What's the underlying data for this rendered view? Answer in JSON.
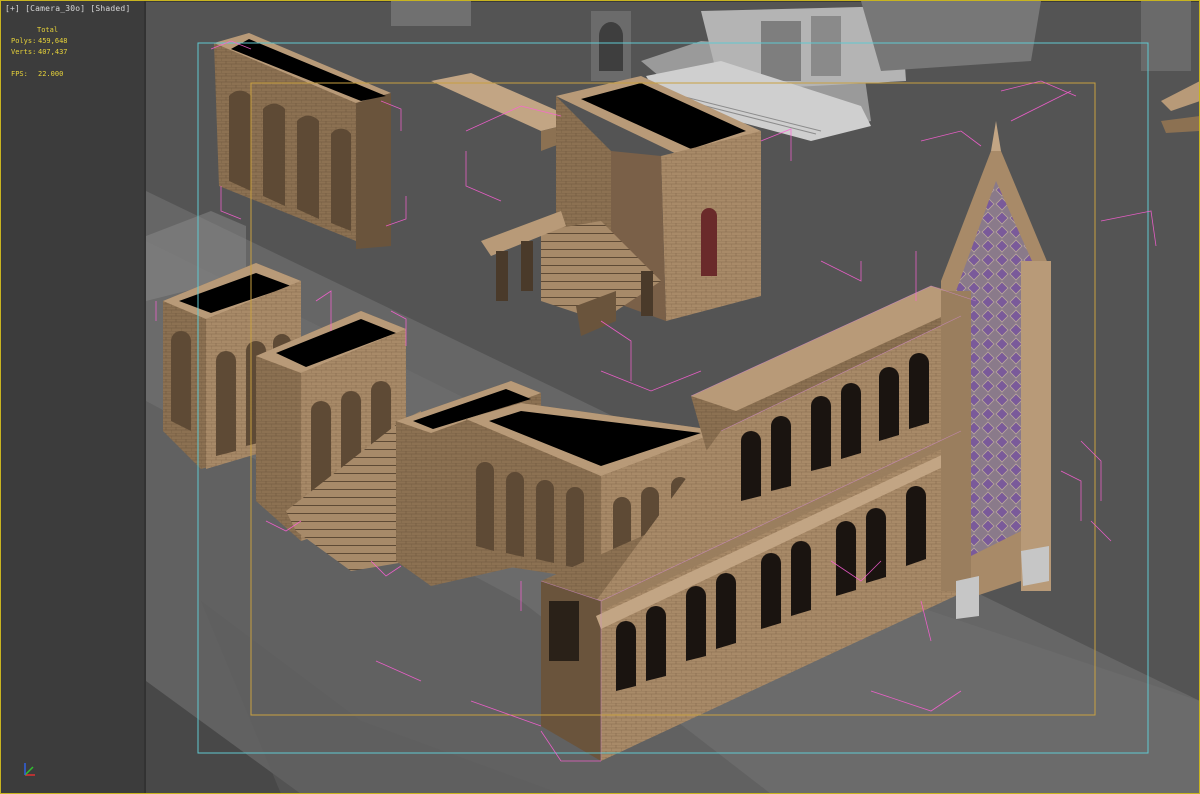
{
  "viewport": {
    "label_plus": "[+]",
    "label_camera": "[Camera_30o]",
    "label_shading": "[Shaded]",
    "stats": {
      "header": "Total",
      "polys_label": "Polys:",
      "polys_value": "459,648",
      "verts_label": "Verts:",
      "verts_value": "407,437",
      "fps_label": "FPS:",
      "fps_value": "22.000"
    }
  },
  "colors": {
    "ground_dark": "#3d3d3d",
    "ground_mid": "#545454",
    "ground_light": "#6a6a6a",
    "stone_light": "#b89a78",
    "stone_mid": "#8c7152",
    "stone_dark": "#5e4a35",
    "safe_frame_outer": "#5fc8d0",
    "safe_frame_inner": "#c8a040",
    "selection_brackets": "#ff5fd8",
    "stained_glass": "#7a5a9a",
    "viewport_border": "#c8b420"
  },
  "gizmo": {
    "axes": [
      "x-axis",
      "y-axis",
      "z-axis"
    ]
  }
}
